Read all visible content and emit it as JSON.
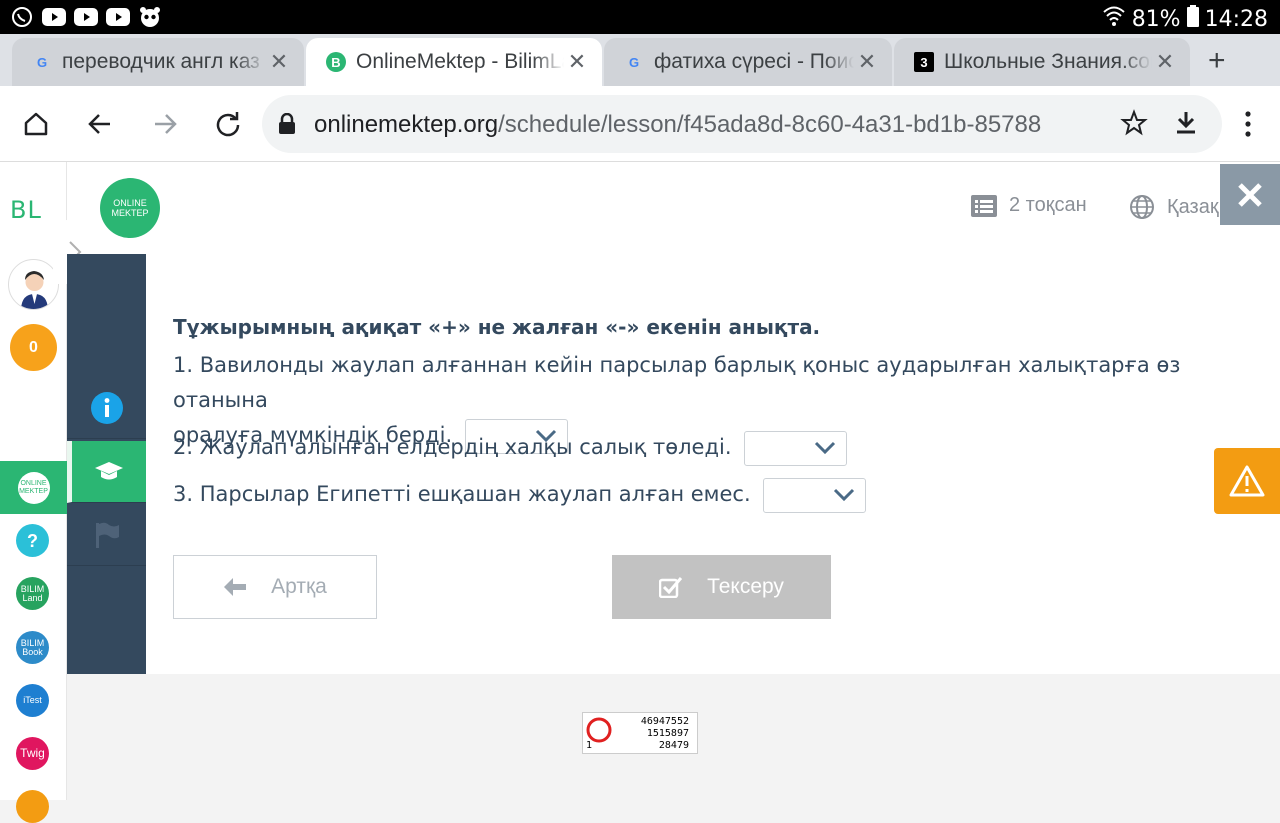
{
  "status": {
    "battery": "81%",
    "time": "14:28"
  },
  "tabs": [
    {
      "title": "переводчик англ каз",
      "favicon": "G",
      "favcolor": "#4285f4"
    },
    {
      "title": "OnlineMektep - BilimLand",
      "favicon": "B",
      "favcolor": "#2bb673"
    },
    {
      "title": "фатиха сүресі - Поиск",
      "favicon": "G",
      "favcolor": "#4285f4"
    },
    {
      "title": "Школьные Знания.com",
      "favicon": "3",
      "favcolor": "#000000"
    }
  ],
  "url": {
    "domain": "onlinemektep.org",
    "path": "/schedule/lesson/f45ada8d-8c60-4a31-bd1b-85788"
  },
  "rail": {
    "brand": "BL",
    "coins": "0",
    "apps": [
      "ONLINE MEKTEP",
      "?",
      "BILIM Land",
      "BILIM Book",
      "iTest",
      "Twig"
    ]
  },
  "header": {
    "logo": "ONLINE MEKTEP",
    "quarter": "2 тоқсан",
    "language": "Қазақ"
  },
  "question": {
    "title": "Тұжырымның ақиқат «+» не жалған «-» екенін анықта.",
    "line1a": "1. Вавилонды жаулап алғаннан кейін парсылар барлық қоныс аударылған халықтарға өз отанына",
    "line1b": "оралуға мүмкіндік берді.",
    "line2": "2. Жаулап алынған елдердің халқы салық төледі.",
    "line3": "3. Парсылар Египетті ешқашан жаулап алған емес."
  },
  "buttons": {
    "back": "Артқа",
    "check": "Тексеру"
  },
  "counter": {
    "line1": "46947552",
    "line2": "1515897",
    "line3": "28479",
    "index": "1"
  },
  "colors": {
    "accent": "#2bb673",
    "nav": "#34495e",
    "warning": "#f39c12"
  }
}
